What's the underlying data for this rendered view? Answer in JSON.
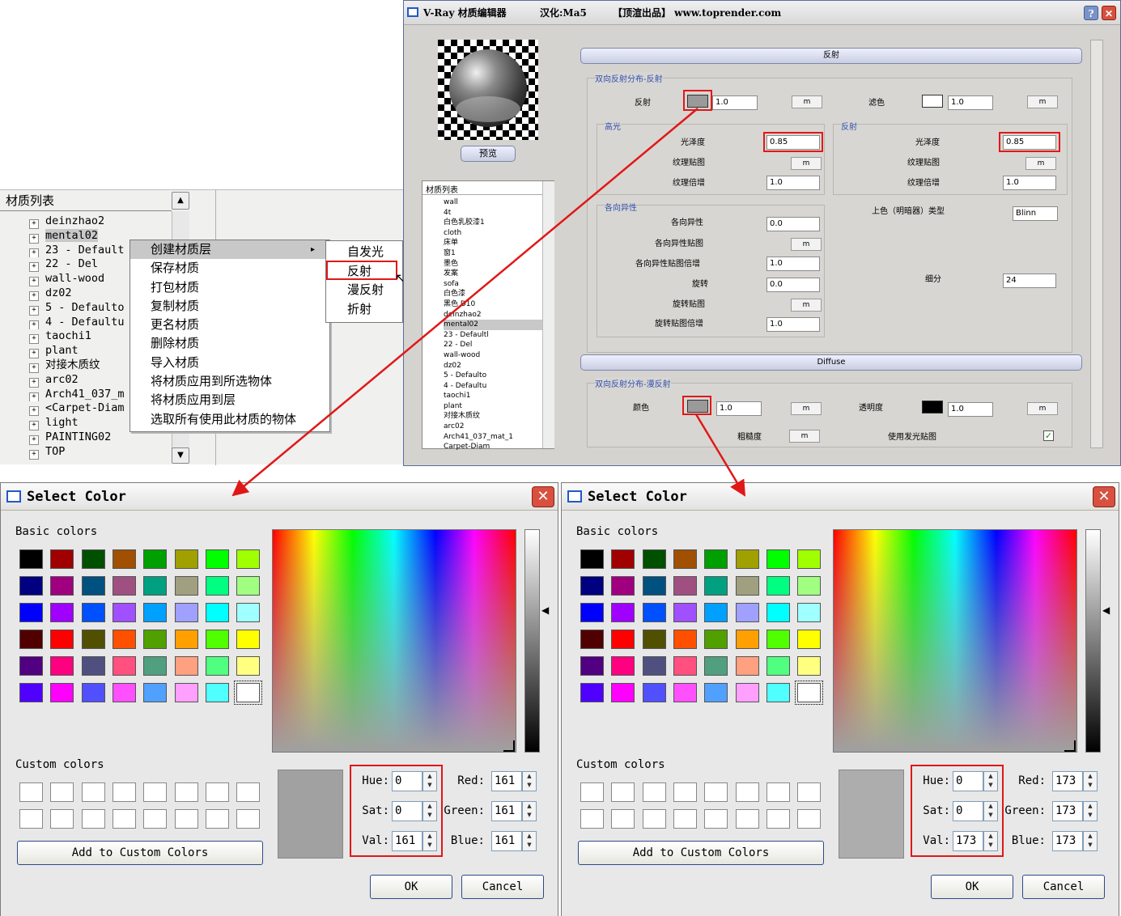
{
  "material_list": {
    "header": "材质列表",
    "items": [
      "deinzhao2",
      "mental02",
      "23 - Default",
      "22 - Del",
      "wall-wood",
      "dz02",
      "5 - Defaulto",
      "4 - Defaultu",
      "taochi1",
      "plant",
      "对接木质纹",
      "arc02",
      "Arch41_037_m",
      "<Carpet-Diam",
      "light",
      "PAINTING02",
      "TOP"
    ]
  },
  "context_menu": {
    "items": [
      "创建材质层",
      "保存材质",
      "打包材质",
      "复制材质",
      "更名材质",
      "删除材质",
      "导入材质",
      "将材质应用到所选物体",
      "将材质应用到层",
      "选取所有使用此材质的物体"
    ],
    "submenu": [
      "自发光",
      "反射",
      "漫反射",
      "折射"
    ]
  },
  "vray_editor": {
    "title": "V-Ray 材质编辑器",
    "localization": "汉化:Ma5",
    "credit": "【顶渲出品】 www.toprender.com",
    "preview_button": "预览",
    "list_label": "材质列表",
    "list_items": [
      "wall",
      "4t",
      "白色乳胶漆1",
      "cloth",
      "床单",
      "窗1",
      "墨色",
      "发案",
      "sofa",
      "白色漆",
      "黑色 D10",
      "deinzhao2",
      "mental02",
      "23 - Defaultl",
      "22 - Del",
      "wall-wood",
      "dz02",
      "5 - Defaulto",
      "4 - Defaultu",
      "taochi1",
      "plant",
      "对接木质纹",
      "arc02",
      "Arch41_037_mat_1",
      "Carpet-Diam"
    ],
    "reflection_bar": "反射",
    "brdf_reflect_group": "双向反射分布-反射",
    "reflect_label": "反射",
    "reflect_value": "1.0",
    "filter_label": "滤色",
    "filter_value": "1.0",
    "specular_group": "高光",
    "reflect_sub_group": "反射",
    "glossiness_label": "光泽度",
    "glossiness_value": "0.85",
    "glossiness_value_2": "0.85",
    "texture_label": "纹理贴图",
    "texture_mult_label": "纹理倍增",
    "texture_mult_value": "1.0",
    "aniso_group": "各向异性",
    "aniso_label": "各向异性",
    "aniso_value": "0.0",
    "aniso_map_label": "各向异性贴图",
    "aniso_mult_label": "各向异性贴图倍增",
    "aniso_mult_value": "1.0",
    "rotation_label": "旋转",
    "rotation_value": "0.0",
    "rotation_map_label": "旋转贴图",
    "rotation_mult_label": "旋转贴图倍增",
    "rotation_mult_value": "1.0",
    "shading_label": "上色（明暗器）类型",
    "shading_value": "Blinn",
    "subdiv_label": "细分",
    "subdiv_value": "24",
    "diffuse_bar": "Diffuse",
    "brdf_diffuse_group": "双向反射分布-漫反射",
    "color_label": "颜色",
    "color_value": "1.0",
    "transparency_label": "透明度",
    "transparency_value": "1.0",
    "roughness_label": "粗糙度",
    "emissive_label": "使用发光贴图",
    "map_button": "m",
    "reflect_swatch_color": "#9a9a9a",
    "diffuse_swatch_color": "#9a9a9a"
  },
  "dialogs": [
    {
      "title": "Select Color",
      "basic_label": "Basic colors",
      "custom_label": "Custom colors",
      "add_button": "Add to Custom Colors",
      "hue_label": "Hue:",
      "hue": "0",
      "sat_label": "Sat:",
      "sat": "0",
      "val_label": "Val:",
      "val": "161",
      "red_label": "Red:",
      "red": "161",
      "green_label": "Green:",
      "green": "161",
      "blue_label": "Blue:",
      "blue": "161",
      "ok": "OK",
      "cancel": "Cancel",
      "preview_color": "#a1a1a1"
    },
    {
      "title": "Select Color",
      "basic_label": "Basic colors",
      "custom_label": "Custom colors",
      "add_button": "Add to Custom Colors",
      "hue_label": "Hue:",
      "hue": "0",
      "sat_label": "Sat:",
      "sat": "0",
      "val_label": "Val:",
      "val": "173",
      "red_label": "Red:",
      "red": "173",
      "green_label": "Green:",
      "green": "173",
      "blue_label": "Blue:",
      "blue": "173",
      "ok": "OK",
      "cancel": "Cancel",
      "preview_color": "#adadad"
    }
  ],
  "basic_colors": [
    [
      "#000000",
      "#a00000",
      "#005000",
      "#a05000",
      "#00a000",
      "#a0a000",
      "#00ff00",
      "#a0ff00"
    ],
    [
      "#000080",
      "#a00080",
      "#005080",
      "#a05080",
      "#00a080",
      "#a0a080",
      "#00ff80",
      "#a0ff80"
    ],
    [
      "#0000ff",
      "#a000ff",
      "#0050ff",
      "#a050ff",
      "#00a0ff",
      "#a0a0ff",
      "#00ffff",
      "#a0ffff"
    ],
    [
      "#500000",
      "#ff0000",
      "#505000",
      "#ff5000",
      "#50a000",
      "#ffa000",
      "#50ff00",
      "#ffff00"
    ],
    [
      "#500080",
      "#ff0080",
      "#505080",
      "#ff5080",
      "#50a080",
      "#ffa080",
      "#50ff80",
      "#ffff80"
    ],
    [
      "#5000ff",
      "#ff00ff",
      "#5050ff",
      "#ff50ff",
      "#50a0ff",
      "#ffa0ff",
      "#50ffff",
      "#ffffff"
    ]
  ],
  "accent_red": "#e01818"
}
